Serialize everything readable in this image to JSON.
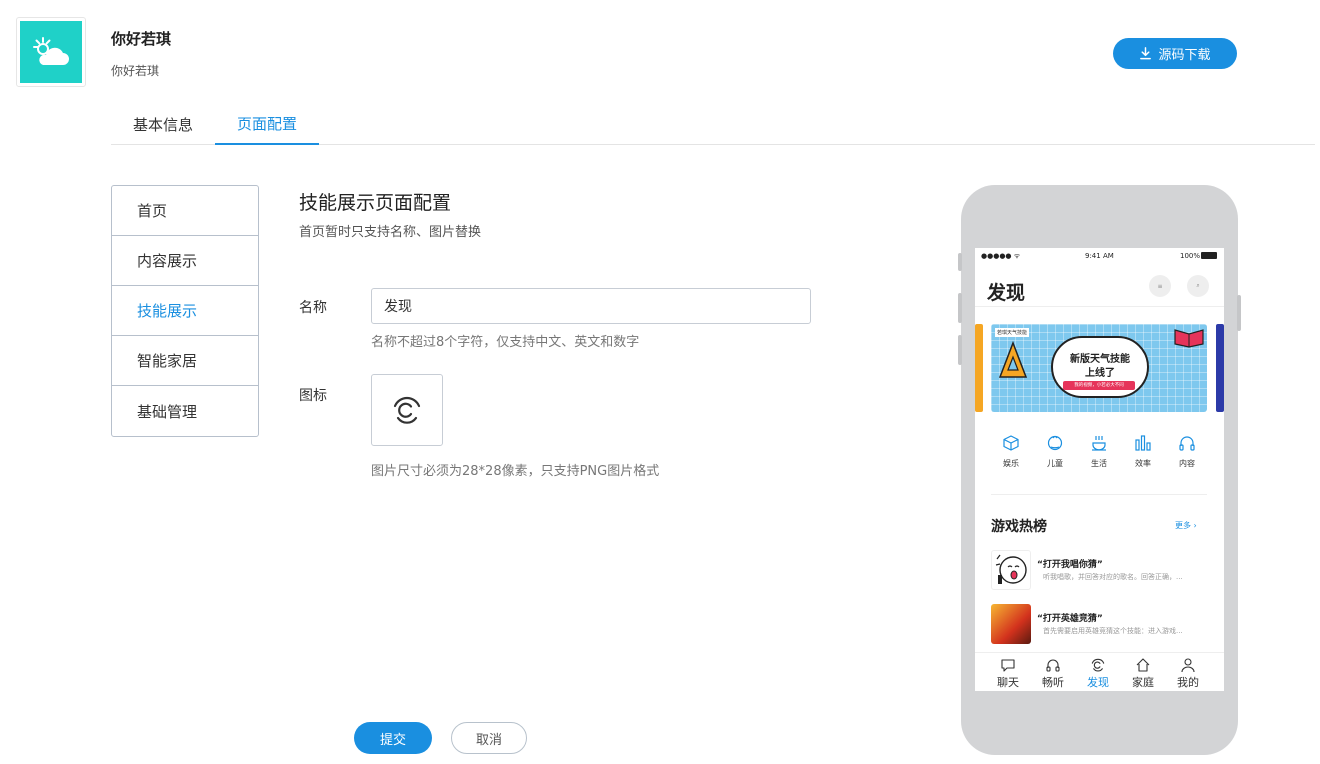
{
  "header": {
    "app_name": "你好若琪",
    "app_subtitle": "你好若琪",
    "download_label": "源码下载",
    "logo_icon": "weather-cloud-icon"
  },
  "tabs": [
    {
      "label": "基本信息",
      "active": false
    },
    {
      "label": "页面配置",
      "active": true
    }
  ],
  "side_menu": [
    {
      "label": "首页",
      "active": false
    },
    {
      "label": "内容展示",
      "active": false
    },
    {
      "label": "技能展示",
      "active": true
    },
    {
      "label": "智能家居",
      "active": false
    },
    {
      "label": "基础管理",
      "active": false
    }
  ],
  "form": {
    "title": "技能展示页面配置",
    "description": "首页暂时只支持名称、图片替换",
    "name_label": "名称",
    "name_value": "发现",
    "name_hint": "名称不超过8个字符，仅支持中文、英文和数字",
    "icon_label": "图标",
    "icon_name": "discover-icon",
    "icon_hint": "图片尺寸必须为28*28像素，只支持PNG图片格式",
    "submit_label": "提交",
    "cancel_label": "取消"
  },
  "phone": {
    "status_signal": "●●●●● ᯤ",
    "status_time": "9:41 AM",
    "status_battery": "100%",
    "page_title": "发现",
    "banner": {
      "tag": "若琪天气技能",
      "line1": "新版天气技能",
      "line2": "上线了",
      "pill": "我的视频，小若必大不同"
    },
    "categories": [
      {
        "label": "娱乐",
        "icon": "cube-icon"
      },
      {
        "label": "儿童",
        "icon": "child-icon"
      },
      {
        "label": "生活",
        "icon": "coffee-icon"
      },
      {
        "label": "效率",
        "icon": "chart-icon"
      },
      {
        "label": "内容",
        "icon": "headphones-icon"
      }
    ],
    "games_title": "游戏热榜",
    "more_label": "更多 ›",
    "games": [
      {
        "title": "“打开我唱你猜”",
        "desc": "听我唱歌，并回答对应的歌名。回答正确，..."
      },
      {
        "title": "“打开英雄竞猜”",
        "desc": "首先需要启用英雄竞猜这个技能：进入游戏..."
      }
    ],
    "tabbar": [
      {
        "label": "聊天",
        "icon": "chat-icon",
        "active": false
      },
      {
        "label": "畅听",
        "icon": "headphones-icon",
        "active": false
      },
      {
        "label": "发现",
        "icon": "discover-icon",
        "active": true
      },
      {
        "label": "家庭",
        "icon": "home-icon",
        "active": false
      },
      {
        "label": "我的",
        "icon": "user-icon",
        "active": false
      }
    ]
  },
  "colors": {
    "accent": "#1a8fe0",
    "logo_bg": "#1fd1c8",
    "phone_frame": "#d3d4d6"
  }
}
